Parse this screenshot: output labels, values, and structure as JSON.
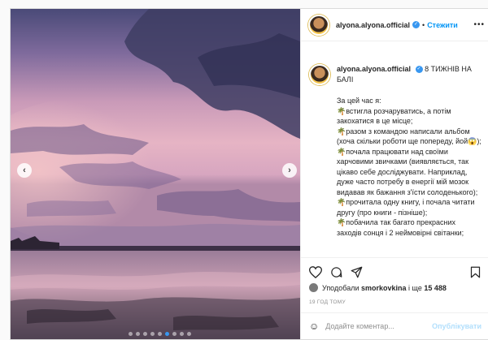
{
  "profile": {
    "username": "alyona.alyona.official",
    "follow_label": "Стежити",
    "separator": "•",
    "more_label": "•••"
  },
  "caption": {
    "username": "alyona.alyona.official",
    "title": "8 ТИЖНІВ НА БАЛІ",
    "body": "За цей час я:\n🌴встигла розчаруватись, а потім закохатися в це місце;\n🌴разом з командою написали альбом (хоча скільки роботи ще попереду, йой😱);\n🌴почала працювати над своїми харчовими звичками (виявляється, так цікаво себе досліджувати. Наприклад, дуже часто потребу в енергії мій мозок видавав як бажання з'їсти солоденького);\n🌴прочитала одну книгу, і почала читати другу (про книги - пізніше);\n🌴побачила так багато прекрасних заходів сонця і 2 неймовірні світанки;"
  },
  "likes": {
    "prefix": "Уподобали",
    "user": "smorkovkina",
    "connector": "і ще",
    "count": "15 488"
  },
  "time_ago": "19 ГОД ТОМУ",
  "comment": {
    "placeholder": "Додайте коментар...",
    "post_label": "Опублікувати",
    "emoji": "☺"
  },
  "carousel": {
    "prev": "‹",
    "next": "›",
    "total": 9,
    "active": 6
  },
  "colors": {
    "accent": "#0095f6",
    "verified": "#3897f0",
    "post_disabled": "#b2dffc"
  }
}
